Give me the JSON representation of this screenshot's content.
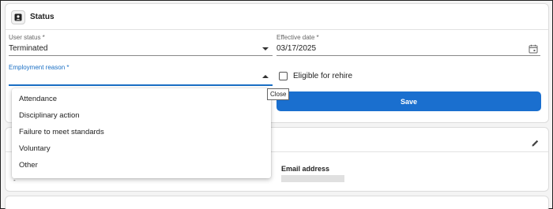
{
  "status_section": {
    "title": "Status",
    "user_status": {
      "label": "User status *",
      "value": "Terminated"
    },
    "effective_date": {
      "label": "Effective date *",
      "value": "03/17/2025"
    },
    "employment_reason": {
      "label": "Employment reason *",
      "value": "",
      "options": [
        "Attendance",
        "Disciplinary action",
        "Failure to meet standards",
        "Voluntary",
        "Other"
      ]
    },
    "eligible_for_rehire": {
      "label": "Eligible for rehire",
      "checked": false
    },
    "tooltip": "Close",
    "save_label": "Save"
  },
  "info_section": {
    "email_label": "Email address",
    "left_value": "-"
  },
  "colors": {
    "accent": "#1a6fcf",
    "focus": "#1a6fc4",
    "card_bg": "#ffffff",
    "page_bg": "#f4f4f4"
  },
  "icons": {
    "status": "person-badge-icon",
    "calendar": "calendar-icon",
    "edit": "pencil-icon"
  }
}
